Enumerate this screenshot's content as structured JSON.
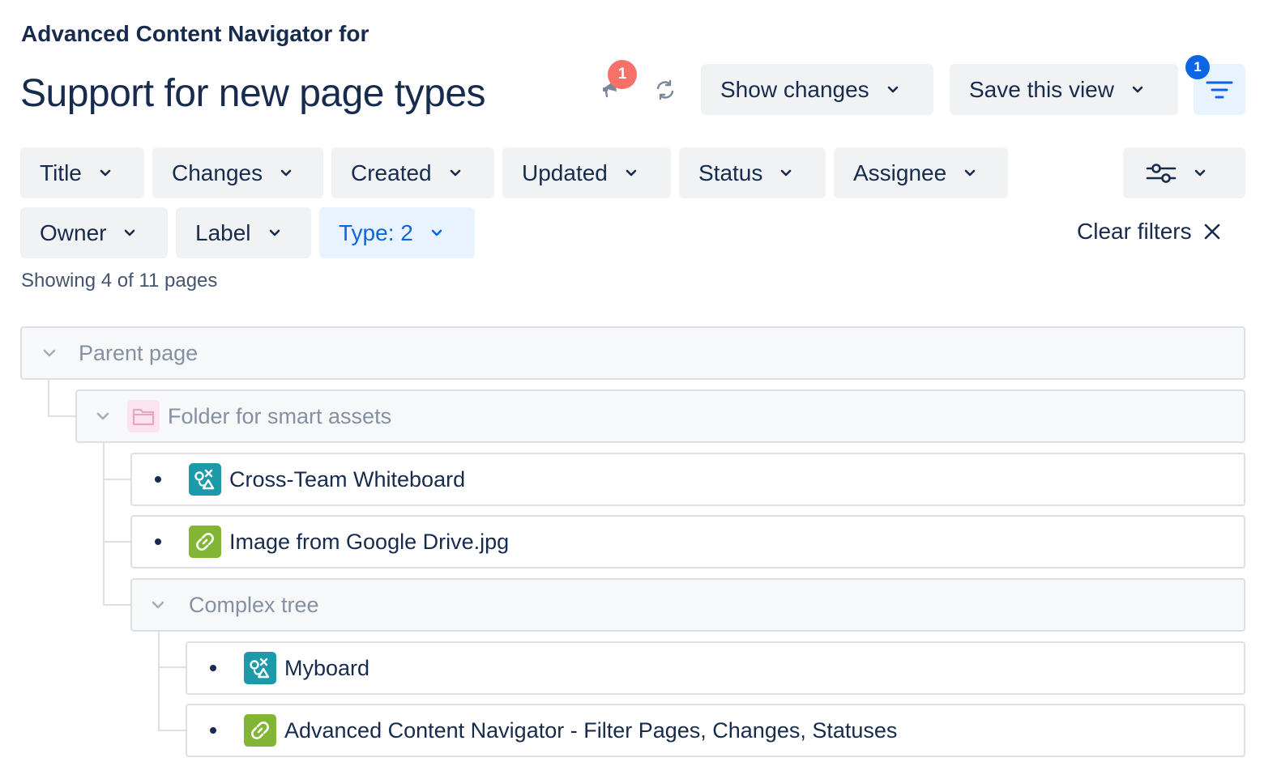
{
  "header": {
    "subtitle": "Advanced Content Navigator for",
    "title": "Support for new page types"
  },
  "toolbar": {
    "notifications_count": "1",
    "show_changes_label": "Show changes",
    "save_view_label": "Save this view",
    "filter_count": "1"
  },
  "filters": {
    "title": "Title",
    "changes": "Changes",
    "created": "Created",
    "updated": "Updated",
    "status": "Status",
    "assignee": "Assignee",
    "owner": "Owner",
    "label": "Label",
    "type": "Type: 2",
    "clear": "Clear filters"
  },
  "results": {
    "showing": "Showing 4 of 11 pages"
  },
  "tree": {
    "parent": "Parent page",
    "folder": "Folder for smart assets",
    "item1": "Cross-Team Whiteboard",
    "item2": "Image from Google Drive.jpg",
    "complex": "Complex tree",
    "item3": "Myboard",
    "item4": "Advanced Content Navigator - Filter Pages, Changes, Statuses"
  },
  "colors": {
    "accent": "#0c66e4",
    "badge_notification": "#f87168",
    "whiteboard_icon": "#1d9aaa",
    "link_icon": "#82b536",
    "folder_icon": "#f5c4dc"
  }
}
